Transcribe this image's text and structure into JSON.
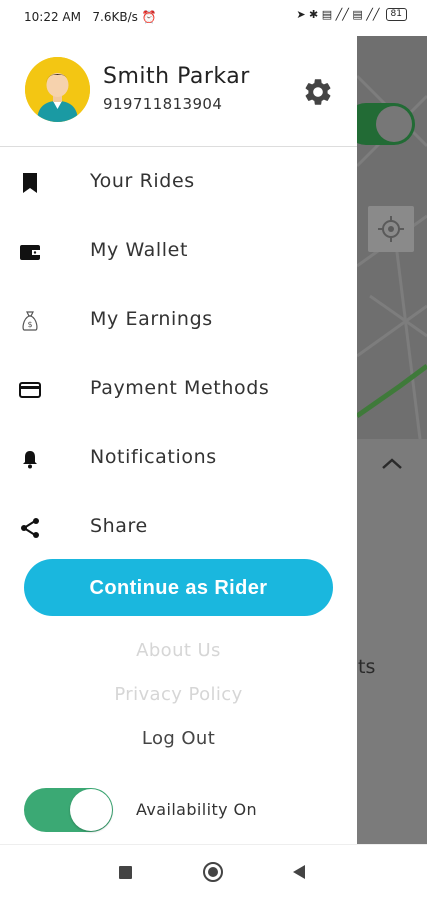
{
  "status_bar": {
    "time": "10:22 AM",
    "speed": "7.6KB/s",
    "alarm_glyph": "⏰",
    "right_icons": "➤ ✱ ▤ ╱╱ ▤ ╱╱",
    "battery": "81"
  },
  "profile": {
    "name": "Smith Parkar",
    "phone": "919711813904",
    "avatar_icon": "person-avatar-icon",
    "settings_icon": "gear-icon"
  },
  "menu": [
    {
      "label": "Your Rides",
      "icon": "bookmark-icon"
    },
    {
      "label": "My Wallet",
      "icon": "wallet-icon"
    },
    {
      "label": "My Earnings",
      "icon": "money-bag-icon"
    },
    {
      "label": "Payment Methods",
      "icon": "credit-card-icon"
    },
    {
      "label": "Notifications",
      "icon": "bell-icon"
    },
    {
      "label": "Share",
      "icon": "share-icon"
    }
  ],
  "cta": {
    "label": "Continue as Rider"
  },
  "links": {
    "about": "About Us",
    "privacy": "Privacy Policy",
    "logout": "Log Out"
  },
  "availability": {
    "label": "Availability On",
    "on": true
  },
  "background": {
    "partial_text": "ts"
  },
  "colors": {
    "accent": "#1ab7de",
    "toggle_on": "#3ba974",
    "avatar_bg": "#f3c613"
  }
}
